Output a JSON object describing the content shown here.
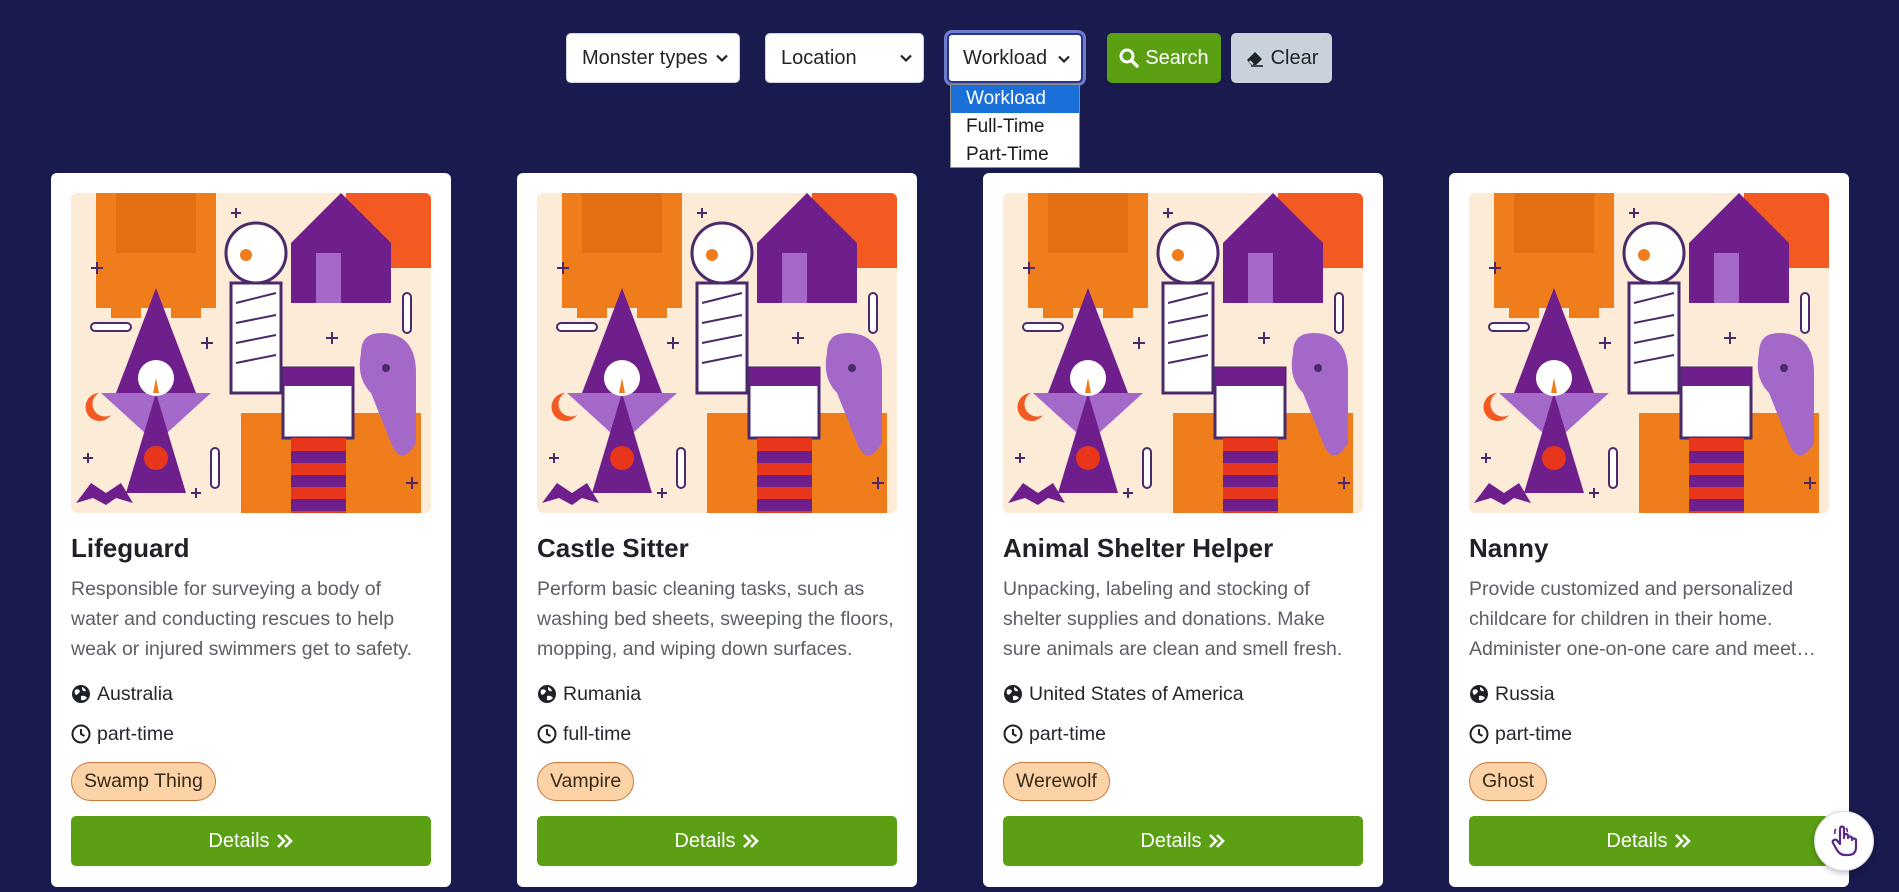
{
  "filters": {
    "monster_types": "Monster types",
    "location": "Location",
    "workload": "Workload",
    "search_label": "Search",
    "clear_label": "Clear",
    "workload_options": [
      "Workload",
      "Full-Time",
      "Part-Time"
    ]
  },
  "cards": [
    {
      "title": "Lifeguard",
      "description": "Responsible for surveying a body of water and conducting rescues to help weak or injured swimmers get to safety.",
      "location": "Australia",
      "workload": "part-time",
      "monster": "Swamp Thing",
      "details_label": "Details"
    },
    {
      "title": "Castle Sitter",
      "description": "Perform basic cleaning tasks, such as washing bed sheets, sweeping the floors, mopping, and wiping down surfaces.",
      "location": "Rumania",
      "workload": "full-time",
      "monster": "Vampire",
      "details_label": "Details"
    },
    {
      "title": "Animal Shelter Helper",
      "description": "Unpacking, labeling and stocking of shelter supplies and donations. Make sure animals are clean and smell fresh.",
      "location": "United States of America",
      "workload": "part-time",
      "monster": "Werewolf",
      "details_label": "Details"
    },
    {
      "title": "Nanny",
      "description": "Provide customized and personalized childcare for children in their home. Administer one-on-one care and meet their needs.",
      "location": "Russia",
      "workload": "part-time",
      "monster": "Ghost",
      "details_label": "Details"
    }
  ],
  "colors": {
    "background": "#191a4d",
    "accent_green": "#5b9f12",
    "badge_fill": "#fbd3a6"
  }
}
